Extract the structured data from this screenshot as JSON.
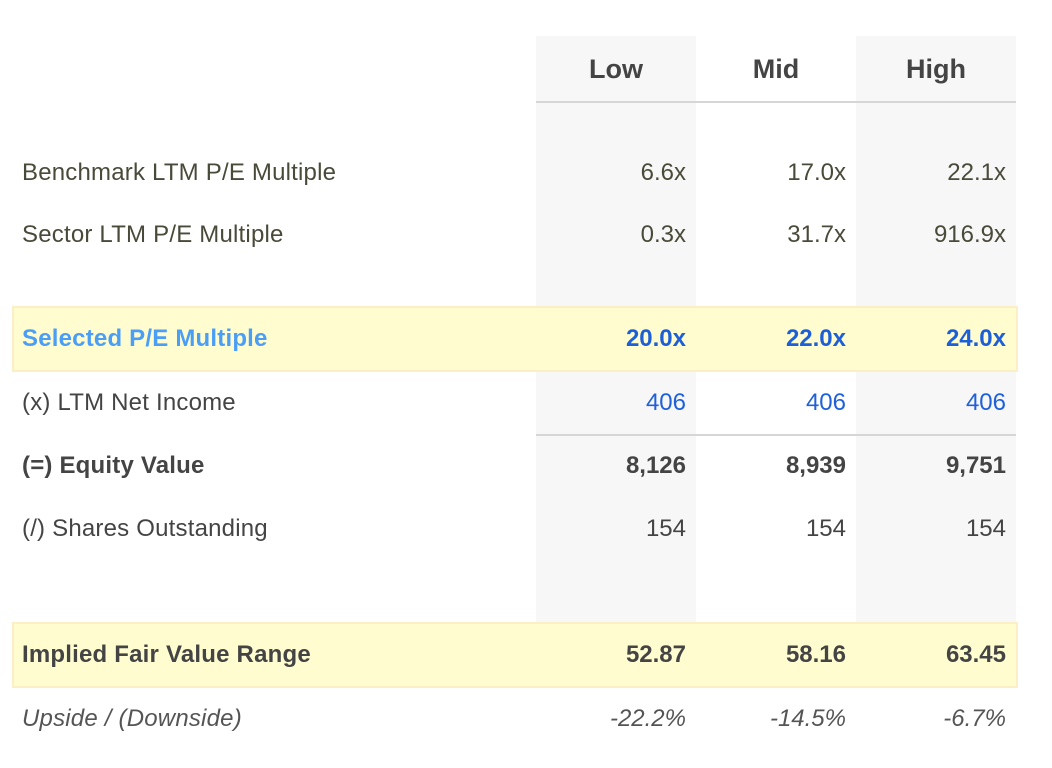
{
  "columns": [
    "Low",
    "Mid",
    "High"
  ],
  "colors": {
    "highlight_bg": "#fffdd0",
    "highlight_border": "#fcefc6",
    "selected_label": "#4b9ef5",
    "selected_values": "#1d5fd6",
    "input_values": "#2060d8",
    "shaded_column": "#f7f7f7"
  },
  "rows": {
    "benchmark": {
      "label": "Benchmark LTM P/E Multiple",
      "values": [
        "6.6x",
        "17.0x",
        "22.1x"
      ]
    },
    "sector": {
      "label": "Sector LTM P/E Multiple",
      "values": [
        "0.3x",
        "31.7x",
        "916.9x"
      ]
    },
    "selected": {
      "label": "Selected P/E Multiple",
      "values": [
        "20.0x",
        "22.0x",
        "24.0x"
      ]
    },
    "net_income": {
      "label": "(x) LTM Net Income",
      "values": [
        "406",
        "406",
        "406"
      ]
    },
    "equity_value": {
      "label": "(=) Equity Value",
      "values": [
        "8,126",
        "8,939",
        "9,751"
      ]
    },
    "shares": {
      "label": "(/) Shares Outstanding",
      "values": [
        "154",
        "154",
        "154"
      ]
    },
    "fair_value": {
      "label": "Implied Fair Value Range",
      "values": [
        "52.87",
        "58.16",
        "63.45"
      ]
    },
    "upside": {
      "label": "Upside / (Downside)",
      "values": [
        "-22.2%",
        "-14.5%",
        "-6.7%"
      ]
    }
  }
}
